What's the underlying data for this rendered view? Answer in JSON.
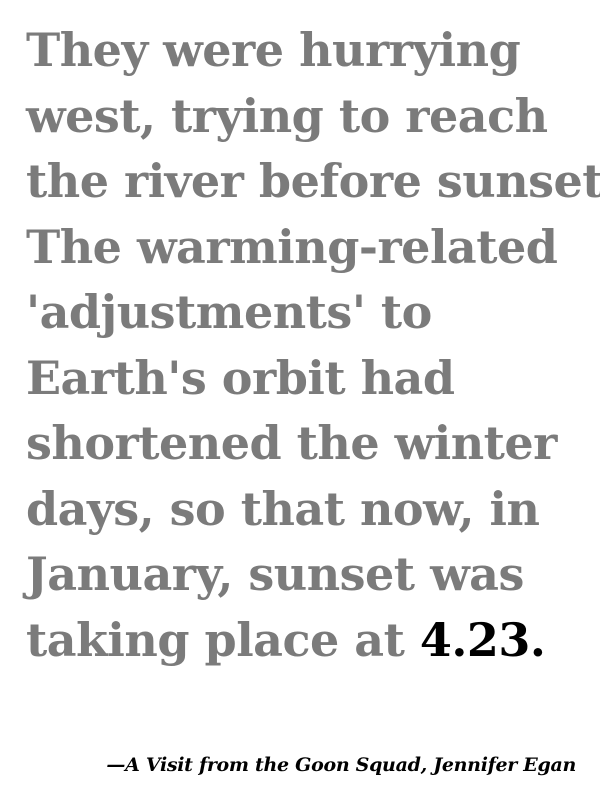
{
  "quote": {
    "lines": [
      "They were hurrying",
      "west, trying to reach",
      "the river before sunset.",
      "The warming-related",
      "'adjustments' to",
      "Earth's orbit had",
      "shortened the winter",
      "days, so that now, in",
      "January, sunset was"
    ],
    "last_line_prefix": "taking place at ",
    "highlight": "4.23.",
    "text_color": "#7b7b7b",
    "highlight_color": "#000000"
  },
  "attribution": "—A Visit from the Goon Squad, Jennifer Egan"
}
